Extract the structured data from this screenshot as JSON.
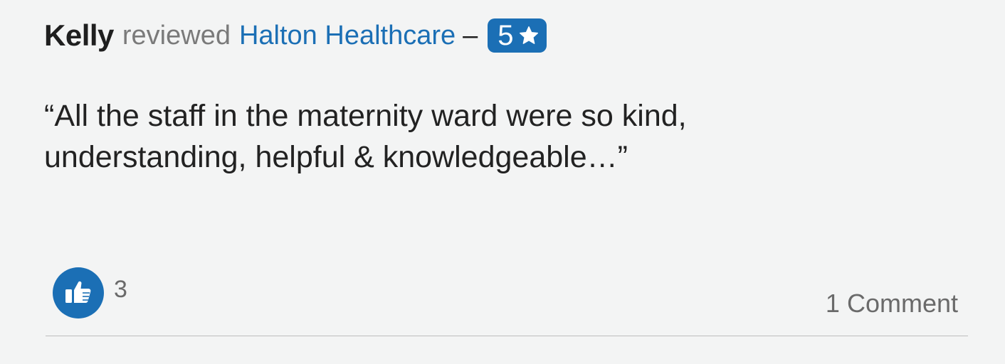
{
  "review": {
    "author": "Kelly",
    "verb": "reviewed",
    "organization": "Halton Healthcare",
    "separator": "–",
    "rating": "5",
    "quote": "“All the staff in the maternity ward were so kind, understanding, helpful & knowledgeable…”"
  },
  "footer": {
    "like_count": "3",
    "comments_label": "1 Comment"
  },
  "icons": {
    "rating": "star-icon",
    "like": "thumbs-up-icon"
  },
  "colors": {
    "accent": "#1b6fb5",
    "background": "#f3f4f4",
    "text": "#222222",
    "muted": "#6a6a6a",
    "divider": "#bdbdbd"
  }
}
